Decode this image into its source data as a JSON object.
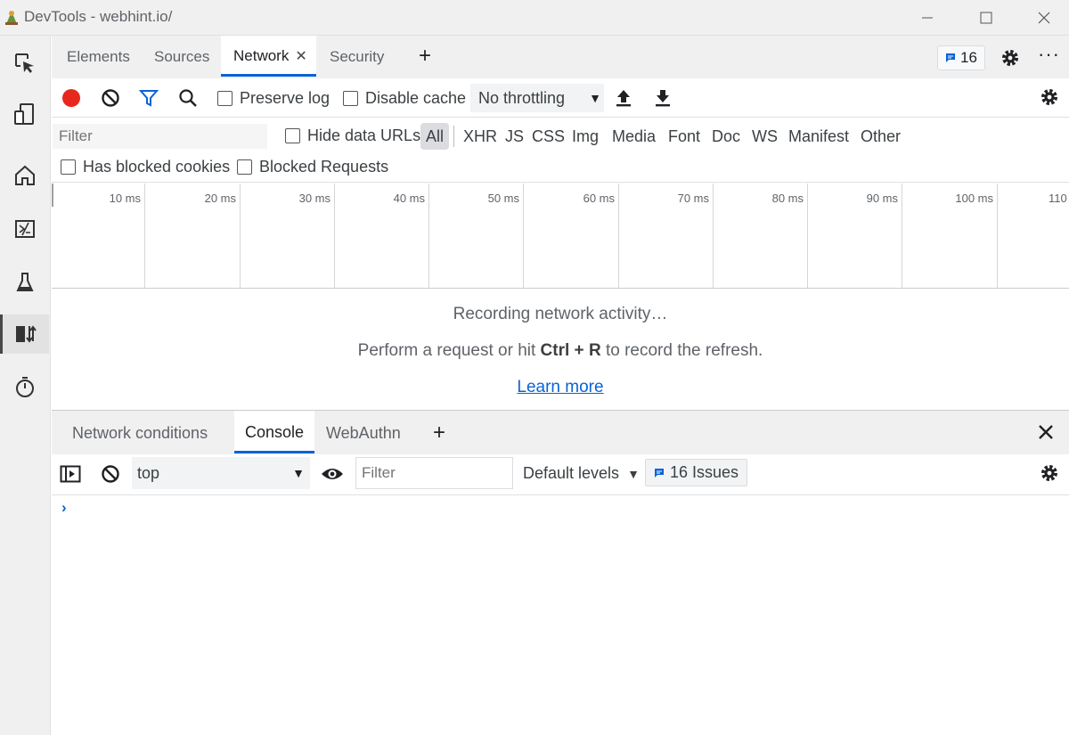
{
  "window": {
    "title": "DevTools - webhint.io/",
    "minimize_icon": "minimize-icon",
    "maximize_icon": "maximize-icon",
    "close_icon": "close-icon"
  },
  "activity_bar": {
    "items": [
      {
        "name": "inspect",
        "icon": "inspect-cursor-icon",
        "selected": false
      },
      {
        "name": "device-emulation",
        "icon": "device-emulation-icon",
        "selected": false
      },
      {
        "name": "welcome",
        "icon": "home-icon",
        "selected": false
      },
      {
        "name": "elements",
        "icon": "elements-icon",
        "selected": false
      },
      {
        "name": "experiments",
        "icon": "flask-icon",
        "selected": false
      },
      {
        "name": "network",
        "icon": "network-icon",
        "selected": true
      },
      {
        "name": "performance",
        "icon": "stopwatch-icon",
        "selected": false
      }
    ]
  },
  "main_tabs": {
    "tabs": [
      {
        "label": "Elements",
        "active": false
      },
      {
        "label": "Sources",
        "active": false
      },
      {
        "label": "Network",
        "active": true,
        "closable": true
      },
      {
        "label": "Security",
        "active": false
      }
    ],
    "add_tab_label": "+",
    "issues_count": "16",
    "more_label": "···"
  },
  "network_toolbar": {
    "preserve_log_label": "Preserve log",
    "disable_cache_label": "Disable cache",
    "throttling_value": "No throttling",
    "accent_record": "#e8281e",
    "accent_filter": "#0a63d6"
  },
  "filter_row": {
    "filter_placeholder": "Filter",
    "hide_data_urls_label": "Hide data URLs",
    "types": [
      "All",
      "XHR",
      "JS",
      "CSS",
      "Img",
      "Media",
      "Font",
      "Doc",
      "WS",
      "Manifest",
      "Other"
    ],
    "selected_type": "All",
    "has_blocked_cookies_label": "Has blocked cookies",
    "blocked_requests_label": "Blocked Requests"
  },
  "timeline": {
    "ticks": [
      "10 ms",
      "20 ms",
      "30 ms",
      "40 ms",
      "50 ms",
      "60 ms",
      "70 ms",
      "80 ms",
      "90 ms",
      "100 ms",
      "110"
    ]
  },
  "empty_state": {
    "recording": "Recording network activity…",
    "hint_prefix": "Perform a request or hit ",
    "hint_key1": "Ctrl",
    "hint_plus": " + ",
    "hint_key2": "R",
    "hint_suffix": " to record the refresh.",
    "learn_more": "Learn more"
  },
  "drawer": {
    "tabs": [
      {
        "label": "Network conditions",
        "active": false
      },
      {
        "label": "Console",
        "active": true
      },
      {
        "label": "WebAuthn",
        "active": false
      }
    ],
    "add_tab_label": "+",
    "context_value": "top",
    "filter_placeholder": "Filter",
    "levels_label": "Default levels",
    "issues_label": "16 Issues",
    "prompt_symbol": "›"
  }
}
